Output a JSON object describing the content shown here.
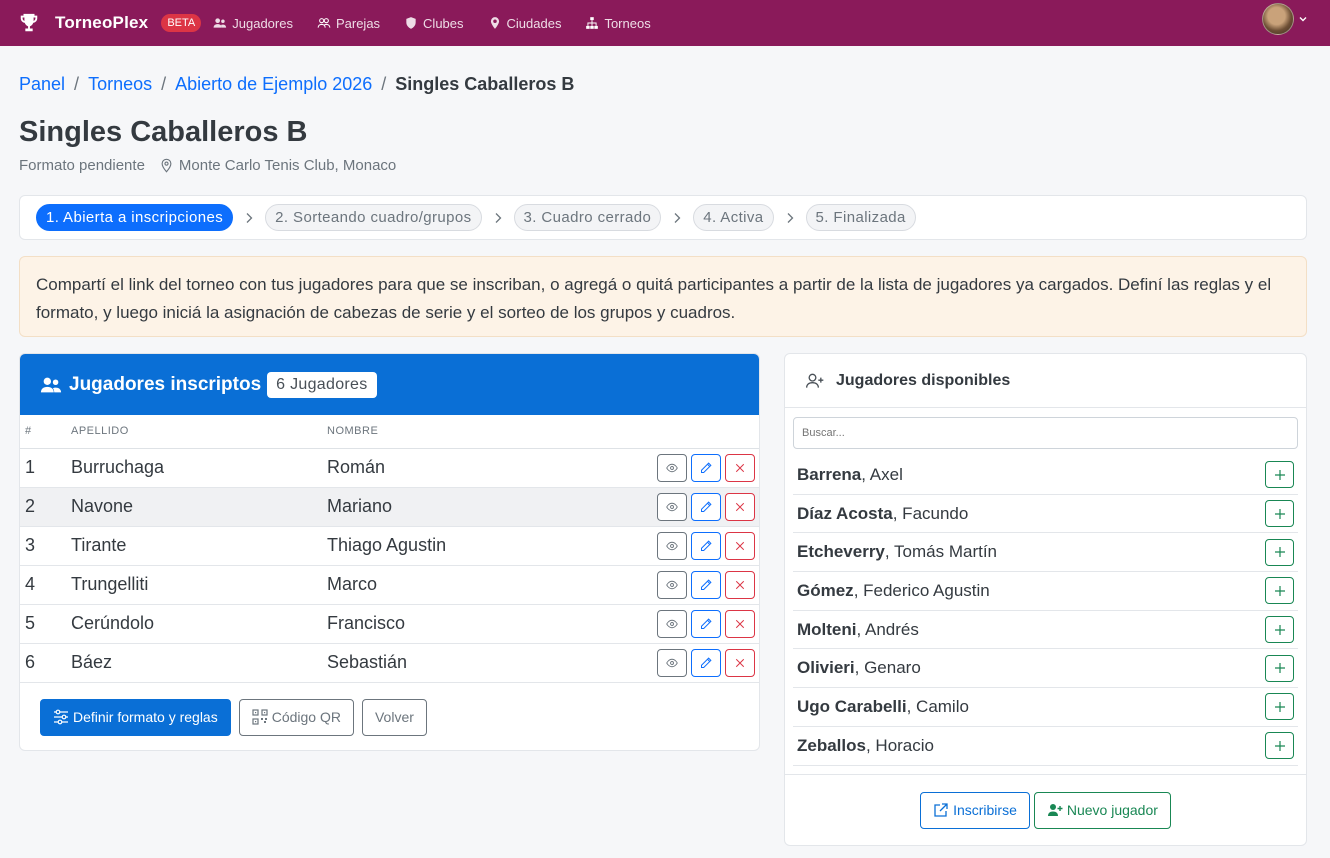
{
  "nav": {
    "brand": "TorneoPlex",
    "beta": "BETA",
    "links": [
      {
        "label": "Jugadores",
        "icon": "users-icon"
      },
      {
        "label": "Parejas",
        "icon": "user-group-icon"
      },
      {
        "label": "Clubes",
        "icon": "shield-icon"
      },
      {
        "label": "Ciudades",
        "icon": "map-pin-icon"
      },
      {
        "label": "Torneos",
        "icon": "sitemap-icon"
      }
    ]
  },
  "breadcrumb": {
    "items": [
      "Panel",
      "Torneos",
      "Abierto de Ejemplo 2026"
    ],
    "active": "Singles Caballeros B",
    "separator": "/"
  },
  "page": {
    "title": "Singles Caballeros B",
    "format": "Formato pendiente",
    "location": "Monte Carlo Tenis Club, Monaco"
  },
  "steps": [
    "1. Abierta a inscripciones",
    "2. Sorteando cuadro/grupos",
    "3. Cuadro cerrado",
    "4. Activa",
    "5. Finalizada"
  ],
  "alert": "Compartí el link del torneo con tus jugadores para que se inscriban, o agregá o quitá participantes a partir de la lista de jugadores ya cargados. Definí las reglas y el formato, y luego iniciá la asignación de cabezas de serie y el sorteo de los grupos y cuadros.",
  "enrolled": {
    "title": "Jugadores inscriptos",
    "count": "6 Jugadores",
    "columns": {
      "num": "#",
      "surname": "APELLIDO",
      "name": "NOMBRE"
    },
    "rows": [
      {
        "num": "1",
        "surname": "Burruchaga",
        "name": "Román"
      },
      {
        "num": "2",
        "surname": "Navone",
        "name": "Mariano"
      },
      {
        "num": "3",
        "surname": "Tirante",
        "name": "Thiago Agustin"
      },
      {
        "num": "4",
        "surname": "Trungelliti",
        "name": "Marco"
      },
      {
        "num": "5",
        "surname": "Cerúndolo",
        "name": "Francisco"
      },
      {
        "num": "6",
        "surname": "Báez",
        "name": "Sebastián"
      }
    ],
    "buttons": {
      "format": "Definir formato y reglas",
      "qr": "Código QR",
      "back": "Volver"
    }
  },
  "available": {
    "title": "Jugadores disponibles",
    "search_placeholder": "Buscar...",
    "players": [
      {
        "surname": "Barrena",
        "name": ", Axel"
      },
      {
        "surname": "Díaz Acosta",
        "name": ", Facundo"
      },
      {
        "surname": "Etcheverry",
        "name": ", Tomás Martín"
      },
      {
        "surname": "Gómez",
        "name": ", Federico Agustin"
      },
      {
        "surname": "Molteni",
        "name": ", Andrés"
      },
      {
        "surname": "Olivieri",
        "name": ", Genaro"
      },
      {
        "surname": "Ugo Carabelli",
        "name": ", Camilo"
      },
      {
        "surname": "Zeballos",
        "name": ", Horacio"
      }
    ],
    "buttons": {
      "enroll": "Inscribirse",
      "new_player": "Nuevo jugador"
    }
  },
  "colors": {
    "navbar": "#8a1a5a",
    "primary": "#0a6fd6",
    "danger": "#dc3545",
    "success": "#198754"
  }
}
